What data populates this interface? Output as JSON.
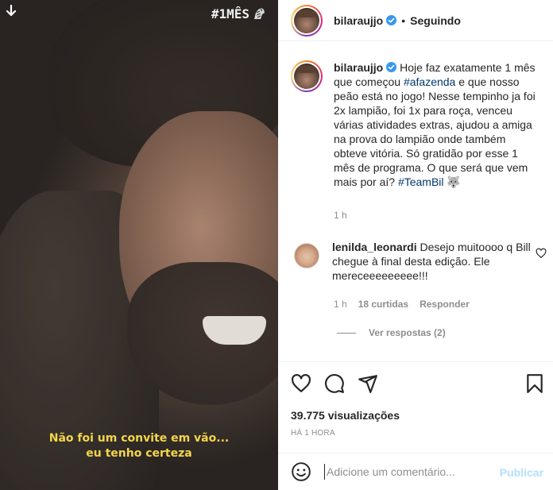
{
  "media": {
    "overlay_hashtag": "#1MÊS",
    "subtitle_line1": "Não foi um convite em vão...",
    "subtitle_line2": "eu tenho certeza",
    "icons": {
      "download": "download-arrow-icon",
      "zebra": "zebra-icon"
    }
  },
  "header": {
    "username": "bilaraujjo",
    "separator": "•",
    "follow_status": "Seguindo"
  },
  "caption": {
    "username": "bilaraujjo",
    "text_1": "Hoje faz exatamente 1 mês que começou ",
    "tag_1": "#afazenda",
    "text_2": " e que nosso peão está no jogo! Nesse tempinho ja foi 2x lampião, foi 1x para roça, venceu várias atividades extras, ajudou a amiga na prova do lampião onde também obteve vitória. Só gratidão por esse 1 mês de programa. O que será que vem mais por aí? ",
    "tag_2": "#TeamBil",
    "emoji": "🐺",
    "time": "1 h"
  },
  "comment": {
    "username": "lenilda_leonardi",
    "text": "Desejo muitoooo q Bill chegue à final desta edição. Ele mereceeeeeeeee!!!",
    "time": "1 h",
    "likes": "18 curtidas",
    "reply": "Responder",
    "view_replies": "Ver respostas (2)"
  },
  "stats": {
    "views": "39.775 visualizações",
    "timestamp": "HÁ 1 HORA"
  },
  "comment_box": {
    "placeholder": "Adicione um comentário...",
    "publish_label": "Publicar"
  },
  "colors": {
    "link": "#00376b",
    "muted": "#8e8e8e",
    "publish_disabled": "#b2dffc",
    "subtitle_yellow": "#f3d64a",
    "verified": "#3897f0"
  }
}
